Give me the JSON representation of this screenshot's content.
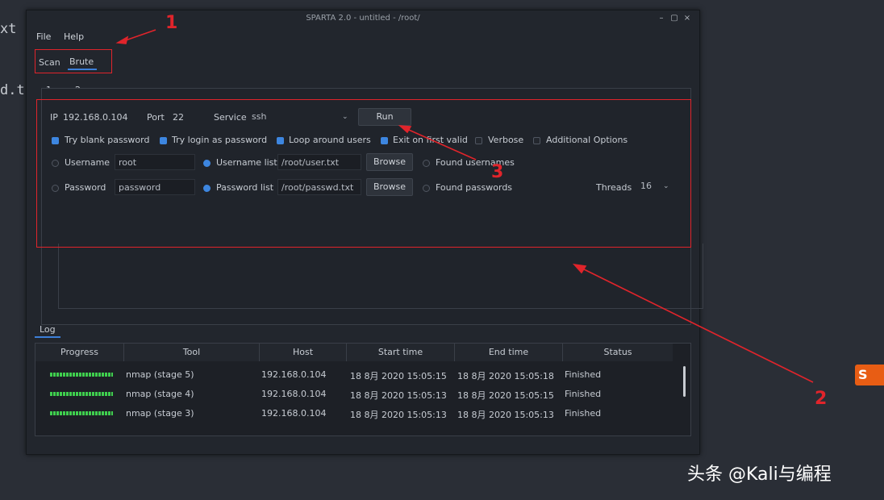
{
  "background": {
    "term_line1": "xt",
    "term_line2": "d.t"
  },
  "window": {
    "title": "SPARTA 2.0 - untitled - /root/",
    "minimize": "–",
    "maximize": "▢",
    "close": "×"
  },
  "menu": {
    "file": "File",
    "help": "Help"
  },
  "tabs": {
    "scan": "Scan",
    "brute": "Brute"
  },
  "subtabs": [
    {
      "label": "1"
    },
    {
      "label": "2"
    }
  ],
  "brute": {
    "ip_label": "IP",
    "ip_value": "192.168.0.104",
    "port_label": "Port",
    "port_value": "22",
    "service_label": "Service",
    "service_value": "ssh",
    "run_label": "Run",
    "options": {
      "try_blank": "Try blank password",
      "try_login": "Try login as password",
      "loop_users": "Loop around users",
      "exit_first": "Exit on first valid",
      "verbose": "Verbose",
      "additional": "Additional Options"
    },
    "username_label": "Username",
    "username_value": "root",
    "username_list_label": "Username list",
    "username_list_value": "/root/user.txt",
    "found_usernames": "Found usernames",
    "password_label": "Password",
    "password_value": "password",
    "password_list_label": "Password list",
    "password_list_value": "/root/passwd.txt",
    "found_passwords": "Found passwords",
    "browse_label": "Browse",
    "threads_label": "Threads",
    "threads_value": "16"
  },
  "log": {
    "tab_label": "Log",
    "columns": [
      "Progress",
      "Tool",
      "Host",
      "Start time",
      "End time",
      "Status"
    ],
    "rows": [
      {
        "progress": 1.0,
        "tool": "nmap (stage 5)",
        "host": "192.168.0.104",
        "start": "18 8月 2020 15:05:15",
        "end": "18 8月 2020 15:05:18",
        "status": "Finished"
      },
      {
        "progress": 1.0,
        "tool": "nmap (stage 4)",
        "host": "192.168.0.104",
        "start": "18 8月 2020 15:05:13",
        "end": "18 8月 2020 15:05:15",
        "status": "Finished"
      },
      {
        "progress": 1.0,
        "tool": "nmap (stage 3)",
        "host": "192.168.0.104",
        "start": "18 8月 2020 15:05:13",
        "end": "18 8月 2020 15:05:13",
        "status": "Finished"
      }
    ]
  },
  "annotations": {
    "n1": "1",
    "n2": "2",
    "n3": "3",
    "color": "#e0242b"
  },
  "watermark": {
    "text": "头条 @Kali与编程",
    "logo": "S"
  },
  "colors": {
    "accent": "#3d7fd8",
    "progress": "#3fcf4e",
    "window_bg": "#22262d"
  }
}
